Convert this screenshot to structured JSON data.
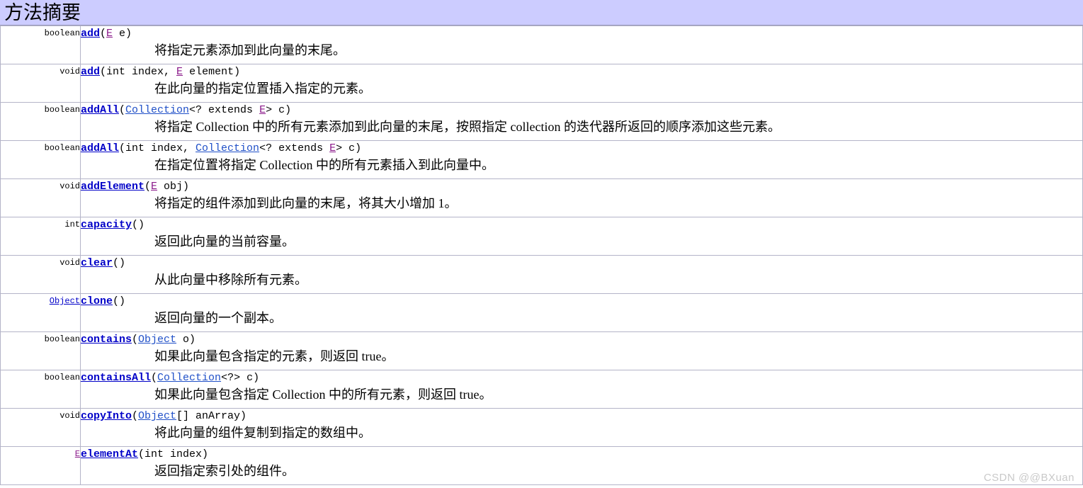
{
  "banner": {
    "title": "方法摘要"
  },
  "watermark": {
    "text": "CSDN @@BXuan"
  },
  "table": {
    "rows": [
      {
        "return_type": "boolean",
        "return_type_style": "plain",
        "method": "add",
        "sig_parts": [
          {
            "t": "plain",
            "v": "("
          },
          {
            "t": "tparam",
            "v": "E"
          },
          {
            "t": "plain",
            "v": " e)"
          }
        ],
        "description": "将指定元素添加到此向量的末尾。"
      },
      {
        "return_type": "void",
        "return_type_style": "plain",
        "method": "add",
        "sig_parts": [
          {
            "t": "plain",
            "v": "(int index, "
          },
          {
            "t": "tparam",
            "v": "E"
          },
          {
            "t": "plain",
            "v": " element)"
          }
        ],
        "description": "在此向量的指定位置插入指定的元素。"
      },
      {
        "return_type": "boolean",
        "return_type_style": "plain",
        "method": "addAll",
        "sig_parts": [
          {
            "t": "plain",
            "v": "("
          },
          {
            "t": "tlink",
            "v": "Collection"
          },
          {
            "t": "plain",
            "v": "<? extends "
          },
          {
            "t": "tparam",
            "v": "E"
          },
          {
            "t": "plain",
            "v": "> c)"
          }
        ],
        "description": "将指定 Collection 中的所有元素添加到此向量的末尾，按照指定 collection 的迭代器所返回的顺序添加这些元素。"
      },
      {
        "return_type": "boolean",
        "return_type_style": "plain",
        "method": "addAll",
        "sig_parts": [
          {
            "t": "plain",
            "v": "(int index, "
          },
          {
            "t": "tlink",
            "v": "Collection"
          },
          {
            "t": "plain",
            "v": "<? extends "
          },
          {
            "t": "tparam",
            "v": "E"
          },
          {
            "t": "plain",
            "v": "> c)"
          }
        ],
        "description": "在指定位置将指定 Collection 中的所有元素插入到此向量中。"
      },
      {
        "return_type": "void",
        "return_type_style": "plain",
        "method": "addElement",
        "sig_parts": [
          {
            "t": "plain",
            "v": "("
          },
          {
            "t": "tparam",
            "v": "E"
          },
          {
            "t": "plain",
            "v": " obj)"
          }
        ],
        "description": "将指定的组件添加到此向量的末尾，将其大小增加 1。"
      },
      {
        "return_type": "int",
        "return_type_style": "plain",
        "method": "capacity",
        "sig_parts": [
          {
            "t": "plain",
            "v": "()"
          }
        ],
        "description": "返回此向量的当前容量。"
      },
      {
        "return_type": "void",
        "return_type_style": "plain",
        "method": "clear",
        "sig_parts": [
          {
            "t": "plain",
            "v": "()"
          }
        ],
        "description": "从此向量中移除所有元素。"
      },
      {
        "return_type": "Object",
        "return_type_style": "link",
        "method": "clone",
        "sig_parts": [
          {
            "t": "plain",
            "v": "()"
          }
        ],
        "description": "返回向量的一个副本。"
      },
      {
        "return_type": "boolean",
        "return_type_style": "plain",
        "method": "contains",
        "sig_parts": [
          {
            "t": "plain",
            "v": "("
          },
          {
            "t": "tlink",
            "v": "Object"
          },
          {
            "t": "plain",
            "v": " o)"
          }
        ],
        "description": "如果此向量包含指定的元素，则返回 true。"
      },
      {
        "return_type": "boolean",
        "return_type_style": "plain",
        "method": "containsAll",
        "sig_parts": [
          {
            "t": "plain",
            "v": "("
          },
          {
            "t": "tlink",
            "v": "Collection"
          },
          {
            "t": "plain",
            "v": "<?> c)"
          }
        ],
        "description": "如果此向量包含指定 Collection 中的所有元素，则返回 true。"
      },
      {
        "return_type": "void",
        "return_type_style": "plain",
        "method": "copyInto",
        "sig_parts": [
          {
            "t": "plain",
            "v": "("
          },
          {
            "t": "tlink",
            "v": "Object"
          },
          {
            "t": "plain",
            "v": "[] anArray)"
          }
        ],
        "description": "将此向量的组件复制到指定的数组中。"
      },
      {
        "return_type": "E",
        "return_type_style": "tparam",
        "method": "elementAt",
        "sig_parts": [
          {
            "t": "plain",
            "v": "(int index)"
          }
        ],
        "description": "返回指定索引处的组件。"
      }
    ]
  },
  "colors": {
    "banner_bg": "#ccccff",
    "link": "#0000c8",
    "type_link": "#2050c8",
    "type_param": "#8b1a8b",
    "border": "#b4b4c8",
    "watermark": "#c9c9c9"
  }
}
